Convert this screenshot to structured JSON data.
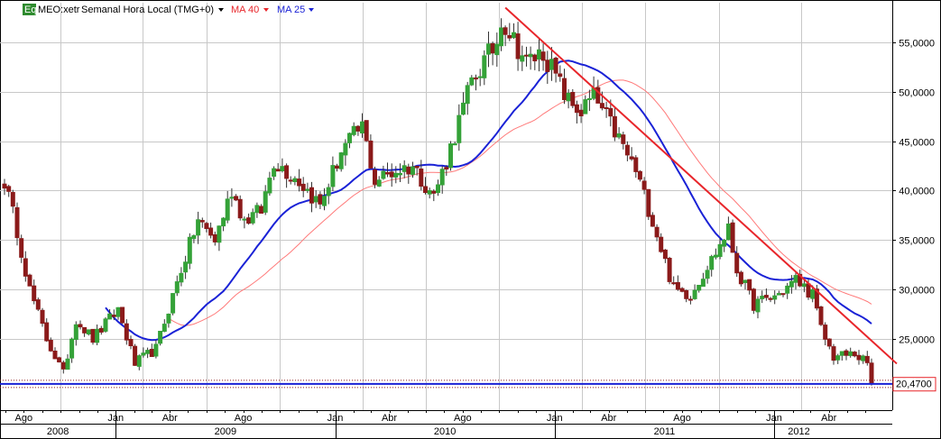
{
  "header": {
    "badge": "Eq",
    "symbol": "MEO:xetr",
    "description": "Semanal Hora Local (TMG+0)",
    "indicators": [
      {
        "label": "MA 40",
        "color": "#e8262b"
      },
      {
        "label": "MA 25",
        "color": "#1a22d6"
      }
    ]
  },
  "price_tag": {
    "value": "20,4700",
    "level": 20.47
  },
  "colors": {
    "up": "#35a238",
    "down": "#8b1a1a",
    "ma40": "#ff7a7a",
    "ma25": "#1a22d6",
    "trendline": "#e8262b",
    "support": "#1a22d6",
    "support_dots": "#8b1a1a",
    "grid": "#c8c8c8"
  },
  "chart_data": {
    "type": "candlestick",
    "x_axis": {
      "months": [
        "Ago",
        "Jan",
        "Abr",
        "Ago",
        "Jan",
        "Abr",
        "Ago",
        "Jan",
        "Abr",
        "Ago",
        "Jan",
        "Abr"
      ],
      "years": [
        "2008",
        "2009",
        "2010",
        "2011",
        "2012"
      ],
      "start": "2008-06-30",
      "end": "2012-06-11"
    },
    "y_axis": {
      "ticks": [
        "25,0000",
        "30,0000",
        "35,0000",
        "40,0000",
        "45,0000",
        "50,0000",
        "55,0000"
      ],
      "tick_values": [
        25,
        30,
        35,
        40,
        45,
        50,
        55
      ],
      "range": [
        17.8,
        59.0
      ],
      "position": "right"
    },
    "grid": true,
    "anchors": [
      [
        "2008-06-30",
        41
      ],
      [
        "2008-07-21",
        36
      ],
      [
        "2008-08-11",
        30
      ],
      [
        "2008-09-08",
        25
      ],
      [
        "2008-10-06",
        21.5
      ],
      [
        "2008-10-27",
        27
      ],
      [
        "2008-11-24",
        25
      ],
      [
        "2009-01-05",
        28
      ],
      [
        "2009-02-02",
        22.5
      ],
      [
        "2009-03-09",
        24
      ],
      [
        "2009-04-20",
        32
      ],
      [
        "2009-05-18",
        37
      ],
      [
        "2009-06-15",
        35
      ],
      [
        "2009-07-13",
        40
      ],
      [
        "2009-08-03",
        37
      ],
      [
        "2009-08-31",
        38
      ],
      [
        "2009-09-21",
        43
      ],
      [
        "2009-11-02",
        41
      ],
      [
        "2009-12-07",
        38.5
      ],
      [
        "2010-01-11",
        44
      ],
      [
        "2010-02-15",
        46.5
      ],
      [
        "2010-03-08",
        41
      ],
      [
        "2010-04-12",
        42
      ],
      [
        "2010-05-10",
        42.5
      ],
      [
        "2010-06-14",
        39.5
      ],
      [
        "2010-07-05",
        43
      ],
      [
        "2010-08-16",
        51
      ],
      [
        "2010-09-27",
        55
      ],
      [
        "2010-10-04",
        57.5
      ],
      [
        "2010-11-15",
        53
      ],
      [
        "2010-12-13",
        54
      ],
      [
        "2011-01-24",
        49
      ],
      [
        "2011-02-14",
        48
      ],
      [
        "2011-03-07",
        49.5
      ],
      [
        "2011-04-11",
        46
      ],
      [
        "2011-05-16",
        42
      ],
      [
        "2011-06-13",
        37
      ],
      [
        "2011-07-18",
        30
      ],
      [
        "2011-08-15",
        29.5
      ],
      [
        "2011-09-19",
        33
      ],
      [
        "2011-10-17",
        36
      ],
      [
        "2011-10-31",
        32
      ],
      [
        "2011-11-28",
        28.5
      ],
      [
        "2012-01-09",
        29.5
      ],
      [
        "2012-02-06",
        31
      ],
      [
        "2012-03-05",
        29.5
      ],
      [
        "2012-03-19",
        26
      ],
      [
        "2012-04-09",
        23.2
      ],
      [
        "2012-05-14",
        23.5
      ],
      [
        "2012-06-04",
        22.5
      ],
      [
        "2012-06-11",
        20.47
      ]
    ],
    "series": [
      {
        "name": "MA 40",
        "type": "line",
        "period": 40
      },
      {
        "name": "MA 25",
        "type": "line",
        "period": 25
      }
    ],
    "trendline": {
      "from": [
        "2010-10-11",
        58.5
      ],
      "to": [
        "2012-07-23",
        22.5
      ]
    },
    "support_level": 20.5,
    "last_value": 20.47
  }
}
